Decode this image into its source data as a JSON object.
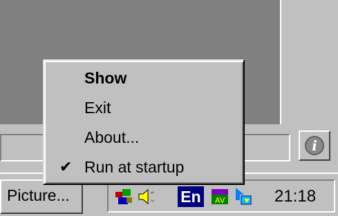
{
  "context_menu": {
    "items": [
      {
        "label": "Show",
        "default": true,
        "checked": false
      },
      {
        "label": "Exit",
        "default": false,
        "checked": false
      },
      {
        "label": "About...",
        "default": false,
        "checked": false
      },
      {
        "label": "Run at startup",
        "default": false,
        "checked": true
      }
    ],
    "check_glyph": "✔"
  },
  "info_button": {
    "icon": "info-icon",
    "glyph": "i"
  },
  "taskbar": {
    "task_button_label": "Picture...",
    "tray": {
      "icons": [
        "network-icon",
        "volume-icon",
        "scheduler-icon",
        "antivirus-icon",
        "connection-arrow-icon"
      ],
      "language": "En",
      "clock": "21:18"
    }
  }
}
